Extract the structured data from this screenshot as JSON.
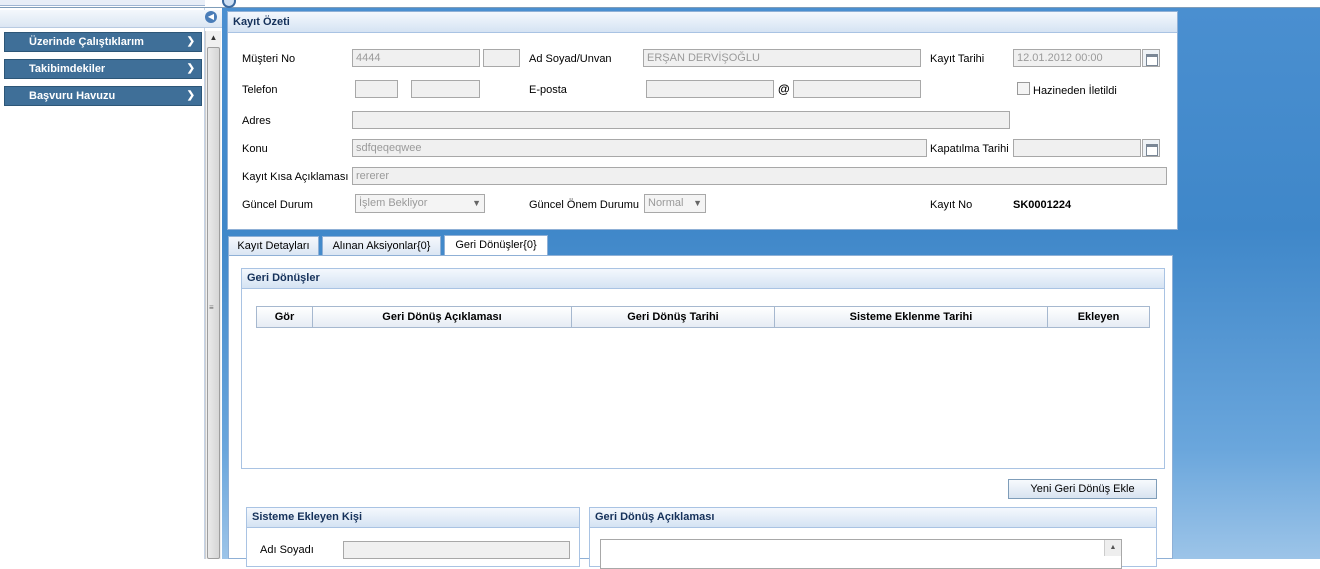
{
  "sidebar": {
    "items": [
      {
        "label": "Üzerinde Çalıştıklarım"
      },
      {
        "label": "Takibimdekiler"
      },
      {
        "label": "Başvuru Havuzu"
      }
    ]
  },
  "summary": {
    "title": "Kayıt Özeti",
    "musteri_no_label": "Müşteri No",
    "musteri_no_value": "4444",
    "musteri_no_extra": "",
    "ad_soyad_label": "Ad Soyad/Unvan",
    "ad_soyad_value": "ERŞAN DERVİŞOĞLU",
    "kayit_tarihi_label": "Kayıt Tarihi",
    "kayit_tarihi_value": "12.01.2012 00:00",
    "telefon_label": "Telefon",
    "telefon_code": "",
    "telefon_number": "",
    "eposta_label": "E-posta",
    "eposta_user": "",
    "at_sign": "@",
    "eposta_domain": "",
    "hazine_label": "Hazineden İletildi",
    "adres_label": "Adres",
    "adres_value": "",
    "konu_label": "Konu",
    "konu_value": "sdfqeqeqwee",
    "kapatilma_label": "Kapatılma Tarihi",
    "kapatilma_value": "",
    "kisa_aciklama_label": "Kayıt Kısa Açıklaması",
    "kisa_aciklama_value": "rererer",
    "guncel_durum_label": "Güncel Durum",
    "guncel_durum_value": "İşlem Bekliyor",
    "onem_label": "Güncel Önem Durumu",
    "onem_value": "Normal",
    "kayit_no_label": "Kayıt No",
    "kayit_no_value": "SK0001224"
  },
  "tabs": [
    {
      "label": "Kayıt Detayları"
    },
    {
      "label": "Alınan Aksiyonlar{0}"
    },
    {
      "label": "Geri Dönüşler{0}"
    }
  ],
  "geri_donusler": {
    "title": "Geri Dönüşler",
    "columns": [
      "Gör",
      "Geri Dönüş Açıklaması",
      "Geri Dönüş Tarihi",
      "Sisteme Eklenme Tarihi",
      "Ekleyen"
    ],
    "add_button": "Yeni Geri Dönüş Ekle"
  },
  "sisteme_ekleyen": {
    "title": "Sisteme Ekleyen Kişi",
    "adi_soyadi_label": "Adı Soyadı",
    "adi_soyadi_value": ""
  },
  "aciklama_panel": {
    "title": "Geri Dönüş Açıklaması",
    "value": ""
  }
}
